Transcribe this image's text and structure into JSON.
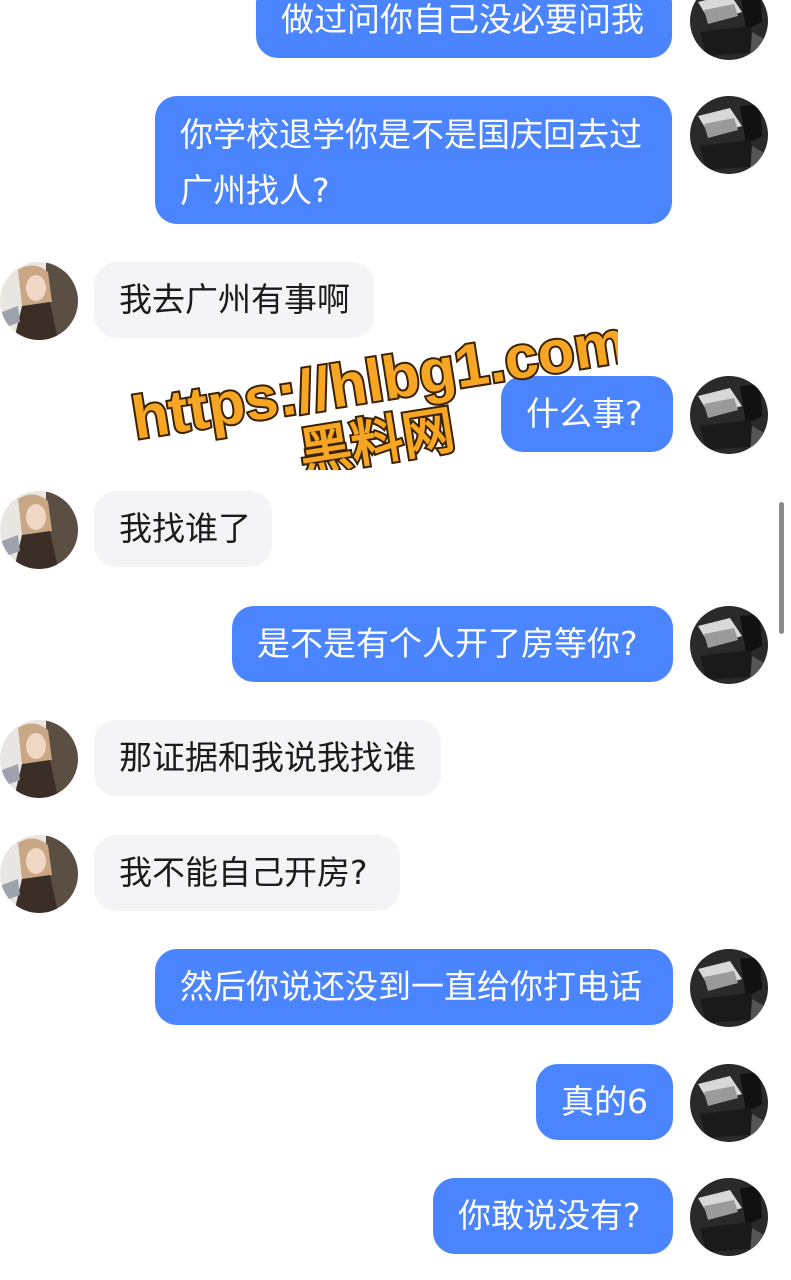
{
  "messages": [
    {
      "sender": "me",
      "lines": [
        "做过问你自己没必要问我"
      ]
    },
    {
      "sender": "me",
      "lines": [
        "你学校退学你是不是国庆回去过",
        "广州找人?"
      ]
    },
    {
      "sender": "them",
      "lines": [
        "我去广州有事啊"
      ]
    },
    {
      "sender": "me",
      "lines": [
        "什么事?"
      ]
    },
    {
      "sender": "them",
      "lines": [
        "我找谁了"
      ]
    },
    {
      "sender": "me",
      "lines": [
        "是不是有个人开了房等你?"
      ]
    },
    {
      "sender": "them",
      "lines": [
        "那证据和我说我找谁"
      ]
    },
    {
      "sender": "them",
      "lines": [
        "我不能自己开房?"
      ]
    },
    {
      "sender": "me",
      "lines": [
        "然后你说还没到一直给你打电话"
      ]
    },
    {
      "sender": "me",
      "lines": [
        "真的6"
      ]
    },
    {
      "sender": "me",
      "lines": [
        "你敢说没有?"
      ]
    }
  ],
  "watermark": {
    "url": "https://hlbg1.com",
    "site_name": "黑料网"
  },
  "colors": {
    "my_bubble": "#4a85ff",
    "their_bubble": "#f4f4f6",
    "watermark_fill": "#f6a623",
    "watermark_stroke": "#3a2200"
  }
}
